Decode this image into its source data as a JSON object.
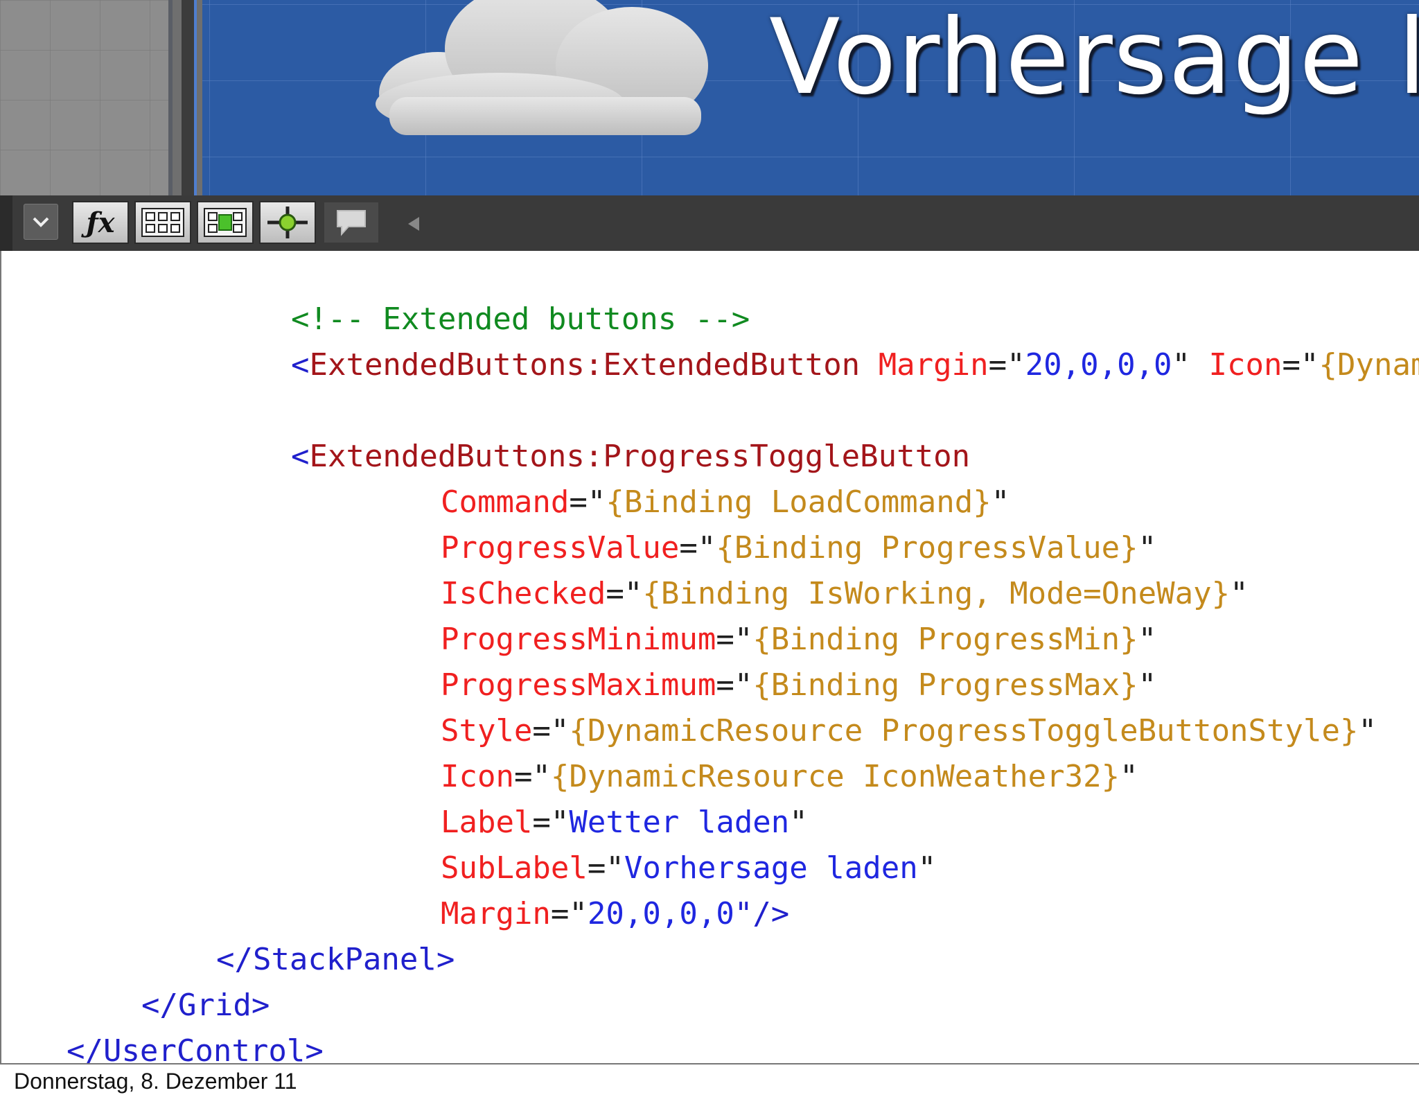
{
  "designer": {
    "preview_title": "Vorhersage l",
    "colors": {
      "preview_background": "#2c5ba4",
      "title_text": "#ffffff"
    }
  },
  "toolbar": {
    "items": [
      {
        "name": "dropdown",
        "icon": "chevron-down-icon"
      },
      {
        "name": "effects",
        "icon": "fx-icon"
      },
      {
        "name": "grid",
        "icon": "grid-icon"
      },
      {
        "name": "snap-to-grid",
        "icon": "snap-grid-icon"
      },
      {
        "name": "snap-to-snaplines",
        "icon": "snapline-icon"
      },
      {
        "name": "annotation",
        "icon": "comment-icon"
      },
      {
        "name": "collapse",
        "icon": "triangle-left-icon"
      }
    ]
  },
  "code": {
    "line1": {
      "comment": "<!-- Extended buttons -->"
    },
    "line2": {
      "open": "<",
      "tag": "ExtendedButtons:ExtendedButton",
      "attr1": "Margin",
      "eq1": "=\"",
      "val1": "20,0,0,0",
      "q1": "\"",
      "attr2": "Icon",
      "eq2": "=\"",
      "val2": "{Dynamic"
    },
    "line3": {
      "open": "<",
      "tag": "ExtendedButtons:ProgressToggleButton"
    },
    "attributes": [
      {
        "name": "Command",
        "value": "{Binding LoadCommand}",
        "kind": "binding"
      },
      {
        "name": "ProgressValue",
        "value": "{Binding ProgressValue}",
        "kind": "binding"
      },
      {
        "name": "IsChecked",
        "value": "{Binding IsWorking, Mode=OneWay}",
        "kind": "binding"
      },
      {
        "name": "ProgressMinimum",
        "value": "{Binding ProgressMin}",
        "kind": "binding"
      },
      {
        "name": "ProgressMaximum",
        "value": "{Binding ProgressMax}",
        "kind": "binding"
      },
      {
        "name": "Style",
        "value": "{DynamicResource ProgressToggleButtonStyle}",
        "kind": "binding"
      },
      {
        "name": "Icon",
        "value": "{DynamicResource IconWeather32}",
        "kind": "binding"
      },
      {
        "name": "Label",
        "value": "Wetter laden",
        "kind": "literal"
      },
      {
        "name": "SubLabel",
        "value": "Vorhersage laden",
        "kind": "literal"
      }
    ],
    "last_attr": {
      "name": "Margin",
      "eq": "=\"",
      "value": "20,0,0,0",
      "close": "\"/>"
    },
    "closing": [
      {
        "text": "</StackPanel>"
      },
      {
        "text": "</Grid>"
      },
      {
        "text": "</UserControl>"
      }
    ],
    "eq_quote": "=\"",
    "end_quote": "\""
  },
  "footer": {
    "date": "Donnerstag, 8. Dezember 11"
  }
}
